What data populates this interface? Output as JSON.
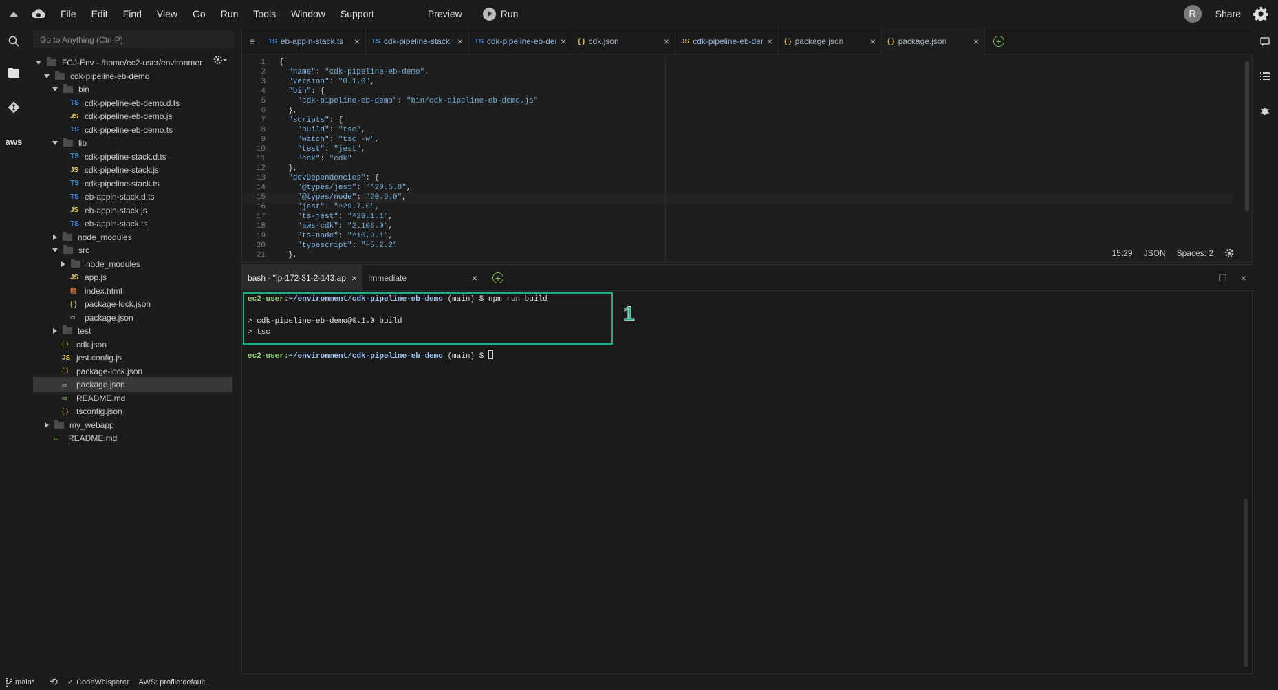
{
  "menubar": {
    "items": [
      "File",
      "Edit",
      "Find",
      "View",
      "Go",
      "Run",
      "Tools",
      "Window",
      "Support"
    ],
    "preview": "Preview",
    "run": "Run",
    "avatar_initial": "R",
    "share": "Share"
  },
  "tree": {
    "goto_placeholder": "Go to Anything (Ctrl-P)",
    "rows": [
      {
        "indent": 0,
        "kind": "folder-open",
        "label": "FCJ-Env - /home/ec2-user/environmer"
      },
      {
        "indent": 1,
        "kind": "folder-open",
        "label": "cdk-pipeline-eb-demo"
      },
      {
        "indent": 2,
        "kind": "folder-open",
        "label": "bin"
      },
      {
        "indent": 3,
        "kind": "ts",
        "label": "cdk-pipeline-eb-demo.d.ts"
      },
      {
        "indent": 3,
        "kind": "js",
        "label": "cdk-pipeline-eb-demo.js"
      },
      {
        "indent": 3,
        "kind": "ts",
        "label": "cdk-pipeline-eb-demo.ts"
      },
      {
        "indent": 2,
        "kind": "folder-open",
        "label": "lib"
      },
      {
        "indent": 3,
        "kind": "ts",
        "label": "cdk-pipeline-stack.d.ts"
      },
      {
        "indent": 3,
        "kind": "js",
        "label": "cdk-pipeline-stack.js"
      },
      {
        "indent": 3,
        "kind": "ts",
        "label": "cdk-pipeline-stack.ts"
      },
      {
        "indent": 3,
        "kind": "ts",
        "label": "eb-appln-stack.d.ts"
      },
      {
        "indent": 3,
        "kind": "js",
        "label": "eb-appln-stack.js"
      },
      {
        "indent": 3,
        "kind": "ts",
        "label": "eb-appln-stack.ts"
      },
      {
        "indent": 2,
        "kind": "folder-closed",
        "label": "node_modules"
      },
      {
        "indent": 2,
        "kind": "folder-open",
        "label": "src"
      },
      {
        "indent": 3,
        "kind": "folder-closed",
        "label": "node_modules"
      },
      {
        "indent": 3,
        "kind": "js",
        "label": "app.js"
      },
      {
        "indent": 3,
        "kind": "html",
        "label": "index.html"
      },
      {
        "indent": 3,
        "kind": "json",
        "label": "package-lock.json"
      },
      {
        "indent": 3,
        "kind": "pkg",
        "label": "package.json"
      },
      {
        "indent": 2,
        "kind": "folder-closed",
        "label": "test"
      },
      {
        "indent": 2,
        "kind": "json",
        "label": "cdk.json"
      },
      {
        "indent": 2,
        "kind": "js",
        "label": "jest.config.js"
      },
      {
        "indent": 2,
        "kind": "json",
        "label": "package-lock.json"
      },
      {
        "indent": 2,
        "kind": "pkg",
        "label": "package.json",
        "selected": true
      },
      {
        "indent": 2,
        "kind": "md",
        "label": "README.md"
      },
      {
        "indent": 2,
        "kind": "json",
        "label": "tsconfig.json"
      },
      {
        "indent": 1,
        "kind": "folder-closed",
        "label": "my_webapp"
      },
      {
        "indent": 1,
        "kind": "md",
        "label": "README.md"
      }
    ]
  },
  "editor": {
    "tabs": [
      {
        "type": "TS",
        "label": "eb-appln-stack.ts"
      },
      {
        "type": "TS",
        "label": "cdk-pipeline-stack.ts"
      },
      {
        "type": "TS",
        "label": "cdk-pipeline-eb-demo."
      },
      {
        "type": "{}",
        "label": "cdk.json"
      },
      {
        "type": "JS",
        "label": "cdk-pipeline-eb-demo."
      },
      {
        "type": "{}",
        "label": "package.json"
      },
      {
        "type": "{}",
        "label": "package.json",
        "active": true
      }
    ],
    "lines": [
      {
        "n": "1",
        "t": "{"
      },
      {
        "n": "2",
        "t": "  \"name\": \"cdk-pipeline-eb-demo\","
      },
      {
        "n": "3",
        "t": "  \"version\": \"0.1.0\","
      },
      {
        "n": "4",
        "t": "  \"bin\": {"
      },
      {
        "n": "5",
        "t": "    \"cdk-pipeline-eb-demo\": \"bin/cdk-pipeline-eb-demo.js\""
      },
      {
        "n": "6",
        "t": "  },"
      },
      {
        "n": "7",
        "t": "  \"scripts\": {"
      },
      {
        "n": "8",
        "t": "    \"build\": \"tsc\","
      },
      {
        "n": "9",
        "t": "    \"watch\": \"tsc -w\","
      },
      {
        "n": "10",
        "t": "    \"test\": \"jest\","
      },
      {
        "n": "11",
        "t": "    \"cdk\": \"cdk\""
      },
      {
        "n": "12",
        "t": "  },"
      },
      {
        "n": "13",
        "t": "  \"devDependencies\": {"
      },
      {
        "n": "14",
        "t": "    \"@types/jest\": \"^29.5.8\","
      },
      {
        "n": "15",
        "t": "    \"@types/node\": \"20.9.0\","
      },
      {
        "n": "16",
        "t": "    \"jest\": \"^29.7.0\","
      },
      {
        "n": "17",
        "t": "    \"ts-jest\": \"^29.1.1\","
      },
      {
        "n": "18",
        "t": "    \"aws-cdk\": \"2.108.0\","
      },
      {
        "n": "19",
        "t": "    \"ts-node\": \"^10.9.1\","
      },
      {
        "n": "20",
        "t": "    \"typescript\": \"~5.2.2\""
      },
      {
        "n": "21",
        "t": "  },"
      }
    ],
    "status": {
      "cursor": "15:29",
      "mode": "JSON",
      "spaces": "Spaces: 2"
    }
  },
  "terminal": {
    "tabs": [
      {
        "label": "bash - \"ip-172-31-2-143.ap",
        "active": true
      },
      {
        "label": "Immediate"
      }
    ],
    "lines": {
      "l1_user": "ec2-user",
      "l1_sep": ":",
      "l1_path": "~/environment/cdk-pipeline-eb-demo",
      "l1_rest": " (main) $ npm run build",
      "l2": "> cdk-pipeline-eb-demo@0.1.0 build",
      "l3": "> tsc",
      "l4_user": "ec2-user",
      "l4_sep": ":",
      "l4_path": "~/environment/cdk-pipeline-eb-demo",
      "l4_rest": " (main) $ "
    },
    "annotation": "1"
  },
  "statusbar": {
    "branch": "main*",
    "codewhisperer": "CodeWhisperer",
    "aws": "AWS: profile:default"
  }
}
